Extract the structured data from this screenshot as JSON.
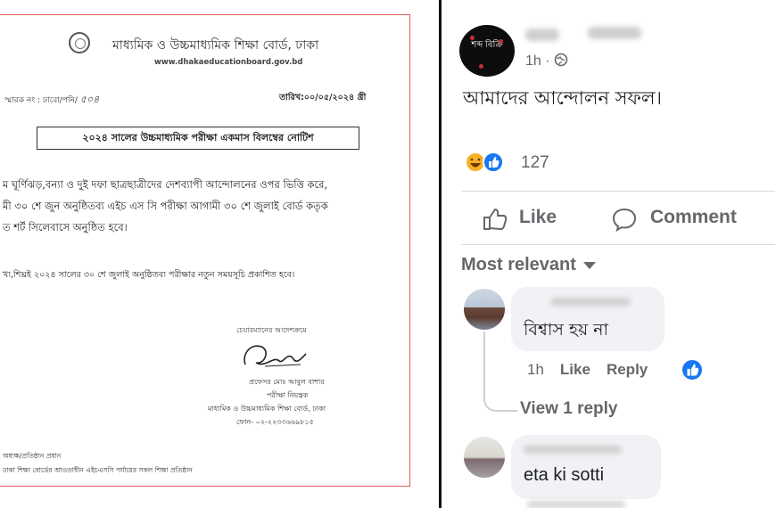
{
  "notice": {
    "board_name": "মাধ্যমিক ও উচ্চমাধ্যমিক শিক্ষা বোর্ড, ঢাকা",
    "website": "www.dhakaeducationboard.gov.bd",
    "memo_label": "স্মারক নং : ঢাবো/পনি/",
    "memo_number": "৫০৪",
    "date": "তারিখ:০০/০৫/২০২৪ খ্রী",
    "subject": "২০২৪ সালের উচ্চমাধ্যমিক পরীক্ষা একমাস বিলম্বের নোটিশ",
    "body_line_1": "ম ঘূর্ণিঝড়,বন্যা ও দুই দফা ছাত্রছাত্রীদের দেশব্যাপী আন্দোলনের ওপর ভিত্তি করে,",
    "body_line_2": "মী ৩০ শে জুন অনুষ্ঠিতব্য এইচ এস সি পরীক্ষা আগামী ৩০ শে জুলাই বোর্ড কতৃক",
    "body_line_3": "ত শর্ট সিলেবাসে অনুষ্ঠিত হবে।",
    "body_line_4": "খ্য,শিঘ্রই ২০২৪ সালের ৩০ শে জুলাই অনুষ্ঠিতব্য পরীক্ষার নতুন সময়সূচি প্রকাশিত হবে।",
    "sig_order": "চেয়ারম্যানের আদেশক্রমে",
    "sig_name": "প্রফেসর মোঃ আবুল বাশার",
    "sig_title": "পরীক্ষা নিয়ন্ত্রক",
    "sig_board": "মাধ্যমিক ও উচ্চমাধ্যমিক শিক্ষা বোর্ড, ঢাকা",
    "sig_phone": "ফোন- ০২-২২৩৩৬৬৯৮১৫",
    "dist_1": "অধ্যক্ষ/প্রতিষ্ঠান প্রধান",
    "dist_2": "ঢাকা শিক্ষা বোর্ডের আওতাধীন এইচএসসি পর্যায়ের সকল শিক্ষা প্রতিষ্ঠান"
  },
  "post": {
    "avatar_text": "শব্দ বিক্রি",
    "time": "1h ·",
    "text": "আমাদের আন্দোলন সফল।",
    "reaction_count": "127",
    "like_label": "Like",
    "comment_label": "Comment",
    "sort_label": "Most relevant"
  },
  "comments": [
    {
      "text": "বিশ্বাস হয় না",
      "time": "1h",
      "like": "Like",
      "reply": "Reply",
      "view_replies": "View 1 reply"
    },
    {
      "text": "eta ki sotti"
    }
  ],
  "colors": {
    "notice_border": "#e0605c",
    "fb_blue": "#1877f2",
    "fb_gray": "#65676b",
    "bubble_bg": "#f0f2f5"
  }
}
